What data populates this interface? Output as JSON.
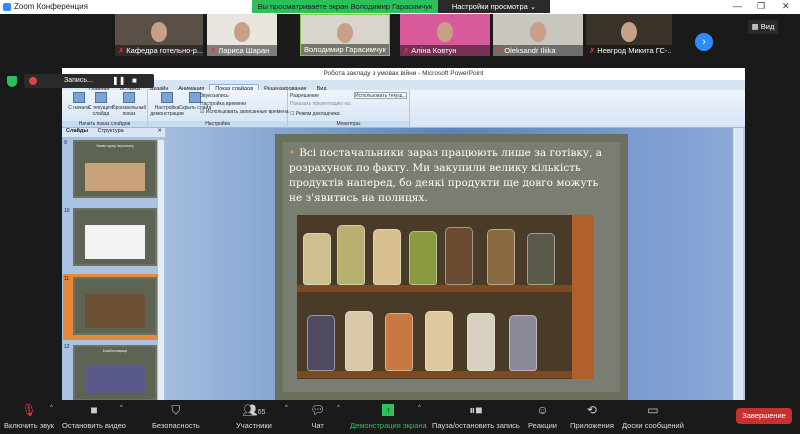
{
  "window": {
    "title": "Zoom Конференция",
    "banner": "Вы просматриваете экран Володимир Гарасимчук",
    "view_options": "Настройки просмотра ⌄",
    "minimize": "—",
    "maximize": "❐",
    "close": "✕"
  },
  "gallery": {
    "participants": [
      {
        "name": "Кафедра готельно-р...",
        "muted": true
      },
      {
        "name": "Лариса Шаран",
        "muted": true
      },
      {
        "name": "Володимир Гарасимчук",
        "muted": false
      },
      {
        "name": "Аліна Ковтун",
        "muted": true
      },
      {
        "name": "Oleksandr Iliika",
        "muted": true
      },
      {
        "name": "Невгрод Микита ГС-...",
        "muted": true
      }
    ],
    "next": "›",
    "view_label": "Вид"
  },
  "recording": {
    "label": "Запись..."
  },
  "ppt": {
    "title": "Робота закладу з умовах війни - Microsoft PowerPoint",
    "tabs": [
      "Главная",
      "Вставка",
      "Дизайн",
      "Анимация",
      "Показ слайдов",
      "Рецензирование",
      "Вид"
    ],
    "active_tab": "Показ слайдов",
    "groups": {
      "start": "Начать показ слайдов",
      "setup": "Настройка",
      "monitors": "Мониторы"
    },
    "buttons": {
      "from_start": "С начала",
      "from_current": "С текущего слайда",
      "custom": "Произвольный показ",
      "setup_show": "Настройка демонстрации",
      "hide_slide": "Скрыть слайд",
      "record": "Звукозапись",
      "rehearse": "Настройка времени",
      "use_timings": "Использовать записанные времена",
      "resolution": "Разрешение",
      "resolution_value": "Использовать текущ...",
      "show_on": "Показать презентацию на:",
      "presenter": "Режим докладчика"
    },
    "panel_tabs": [
      "Слайды",
      "Структура"
    ],
    "thumbs": [
      {
        "num": "9",
        "title": "Умови праці персоналу"
      },
      {
        "num": "10",
        "title": ""
      },
      {
        "num": "11",
        "title": ""
      },
      {
        "num": "12",
        "title": "Бомбосховище"
      }
    ],
    "slide_text": "Всі постачальники зараз працюють лише за готівку, а розрахунок по факту. Ми закупили велику кількість продуктів наперед, бо деякі продукти ще довго можуть не з'явитись на полицях."
  },
  "toolbar": {
    "unmute": "Включить звук",
    "video": "Остановить видео",
    "security": "Безопасность",
    "participants": "Участники",
    "participants_count": "65",
    "chat": "Чат",
    "share": "Демонстрация экрана",
    "record": "Пауза/остановить запись",
    "reactions": "Реакции",
    "apps": "Приложения",
    "whiteboards": "Доски сообщений",
    "end": "Завершение"
  },
  "colors": {
    "share_green": "#2bc15a",
    "end_red": "#c63030",
    "accent_blue": "#2d8cff"
  }
}
